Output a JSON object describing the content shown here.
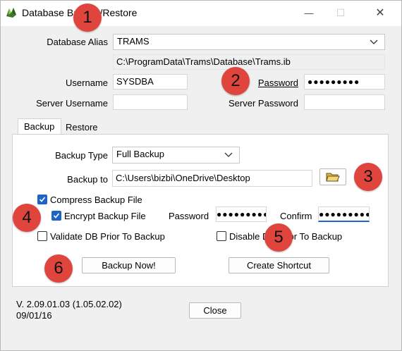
{
  "window": {
    "title": "Database Backup/Restore",
    "minimize": "—",
    "maximize": "☐",
    "close": "✕"
  },
  "db": {
    "alias_label": "Database Alias",
    "alias_value": "TRAMS",
    "path": "C:\\ProgramData\\Trams\\Database\\Trams.ib",
    "username_label": "Username",
    "username_value": "SYSDBA",
    "password_label": "Password",
    "password_value": "●●●●●●●●●",
    "server_username_label": "Server Username",
    "server_username_value": "",
    "server_password_label": "Server Password",
    "server_password_value": ""
  },
  "tabs": {
    "backup": "Backup",
    "restore": "Restore"
  },
  "backup": {
    "type_label": "Backup Type",
    "type_value": "Full Backup",
    "to_label": "Backup to",
    "to_value": "C:\\Users\\bizbi\\OneDrive\\Desktop",
    "compress_label": "Compress Backup File",
    "compress_checked": true,
    "encrypt_label": "Encrypt Backup File",
    "encrypt_checked": true,
    "enc_password_label": "Password",
    "enc_password_value": "●●●●●●●●●",
    "confirm_label": "Confirm",
    "confirm_value": "●●●●●●●●●",
    "validate_label": "Validate DB Prior To Backup",
    "validate_checked": false,
    "disable_label": "Disable DB Prior To Backup",
    "disable_checked": false,
    "backup_now": "Backup Now!",
    "create_shortcut": "Create Shortcut"
  },
  "footer": {
    "version": "V. 2.09.01.03 (1.05.02.02)",
    "date": "09/01/16",
    "close": "Close"
  },
  "annotations": [
    "1",
    "2",
    "3",
    "4",
    "5",
    "6"
  ],
  "colors": {
    "accent": "#1e64c8",
    "annotation": "#e0453d",
    "background": "#f0f0f0"
  }
}
